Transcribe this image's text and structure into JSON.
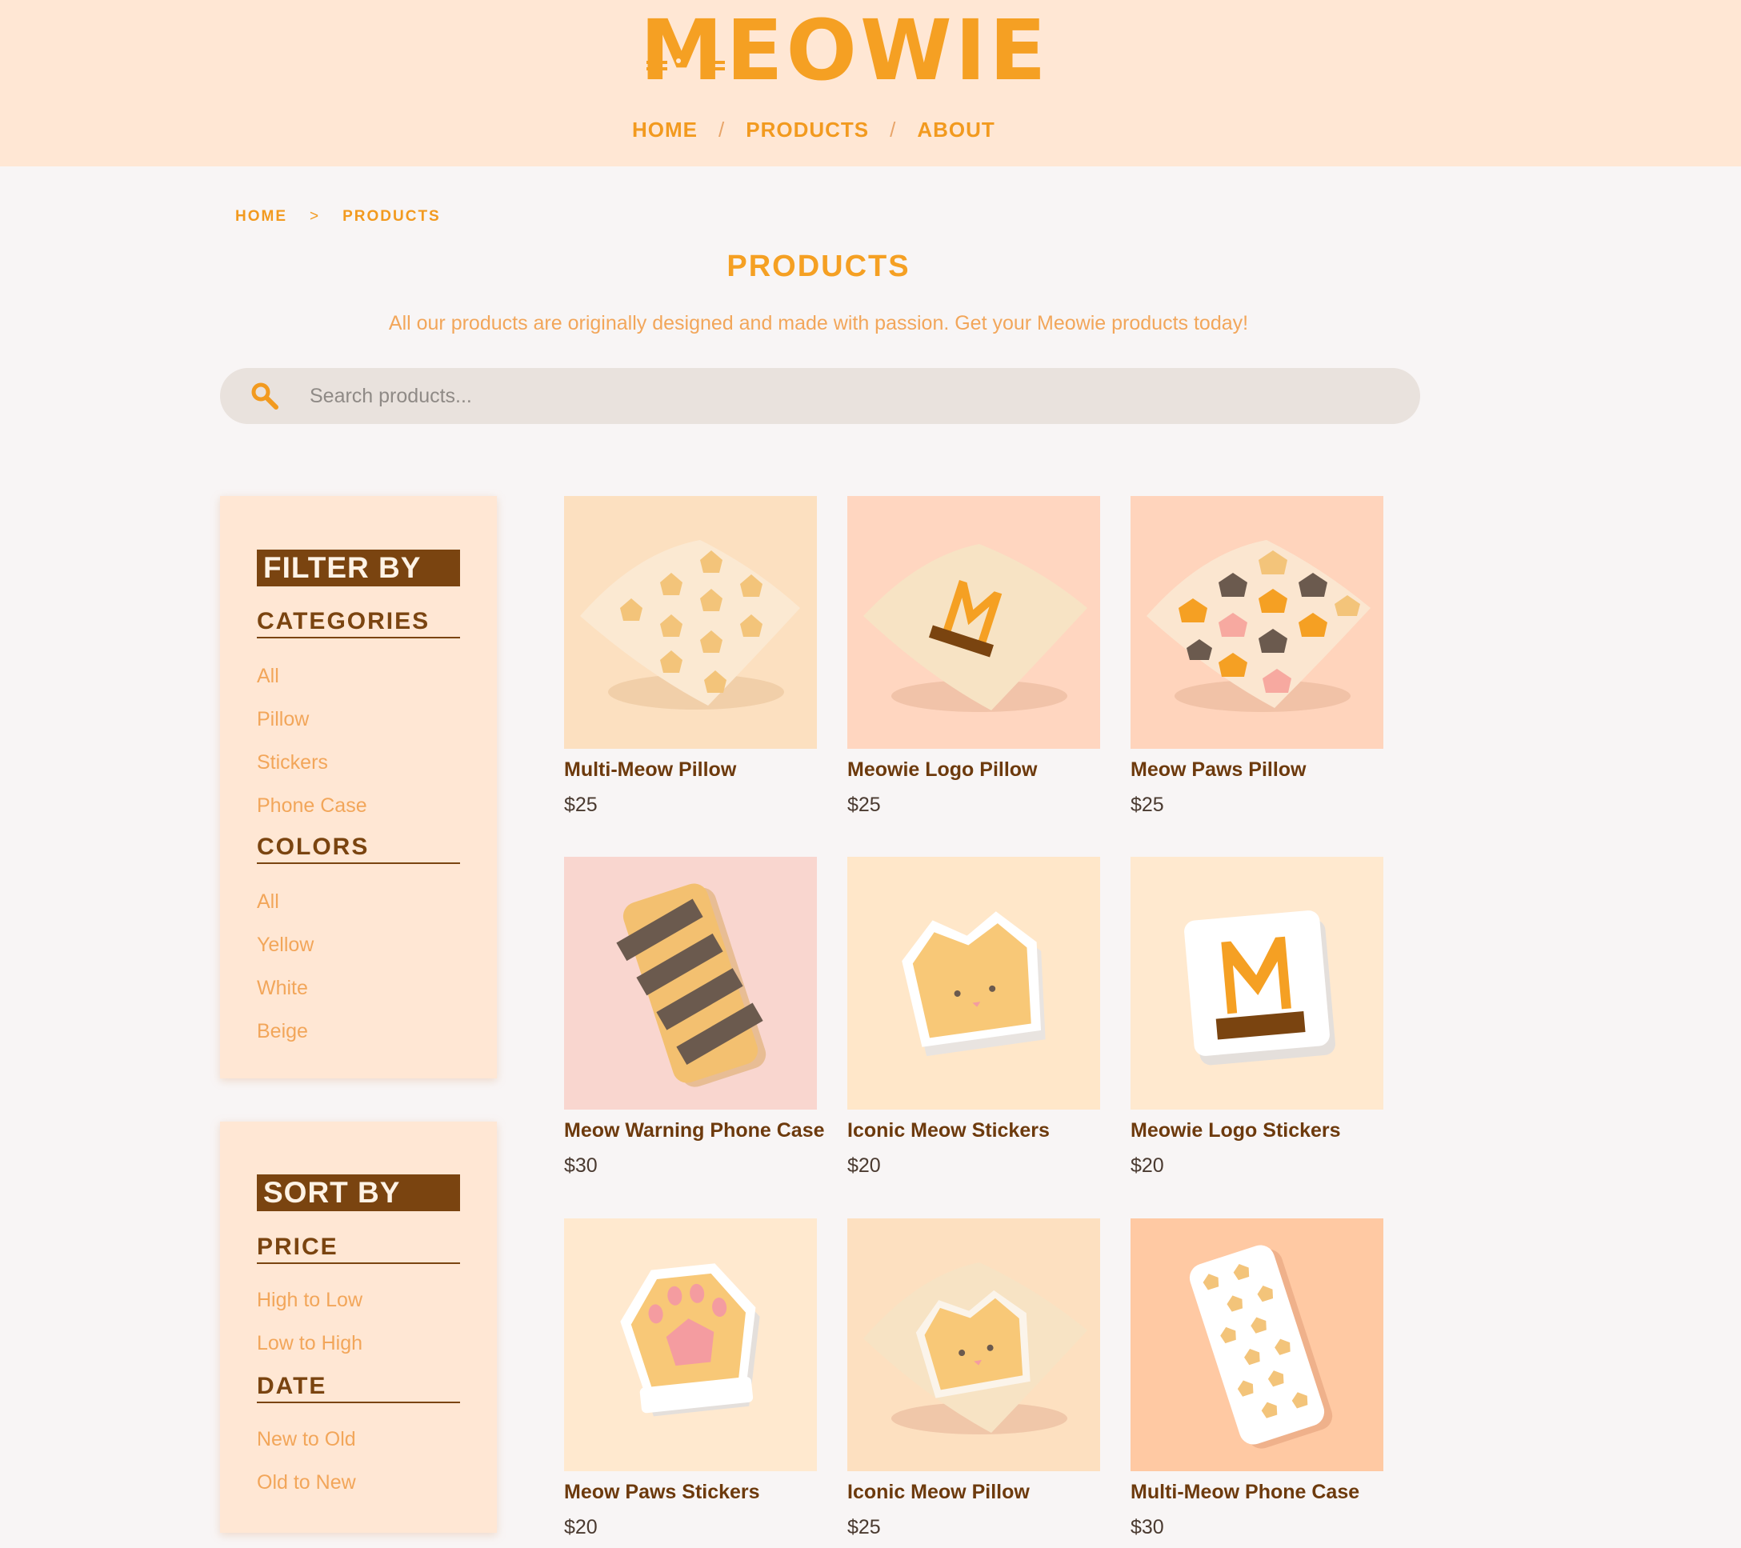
{
  "site": {
    "logo_text": "MEOWIE",
    "nav": {
      "home": "HOME",
      "products": "PRODUCTS",
      "about": "ABOUT",
      "separator": "/"
    }
  },
  "breadcrumb": {
    "home": "HOME",
    "separator": ">",
    "current": "PRODUCTS"
  },
  "page": {
    "title": "PRODUCTS",
    "subtitle": "All our products are originally designed and made with passion. Get your Meowie products today!"
  },
  "search": {
    "placeholder": "Search products..."
  },
  "filter": {
    "heading": "FILTER BY",
    "categories": {
      "title": "CATEGORIES",
      "options": [
        "All",
        "Pillow",
        "Stickers",
        "Phone Case"
      ]
    },
    "colors": {
      "title": "COLORS",
      "options": [
        "All",
        "Yellow",
        "White",
        "Beige"
      ]
    }
  },
  "sort": {
    "heading": "SORT BY",
    "price": {
      "title": "PRICE",
      "options": [
        "High to Low",
        "Low to High"
      ]
    },
    "date": {
      "title": "DATE",
      "options": [
        "New to Old",
        "Old to New"
      ]
    }
  },
  "products": [
    {
      "name": "Multi-Meow Pillow",
      "price": "$25",
      "bg": "#fce0c0"
    },
    {
      "name": "Meowie Logo Pillow",
      "price": "$25",
      "bg": "#ffd6c0"
    },
    {
      "name": "Meow Paws Pillow",
      "price": "$25",
      "bg": "#ffd4bc"
    },
    {
      "name": "Meow Warning Phone Case",
      "price": "$30",
      "bg": "#f9d6cf"
    },
    {
      "name": "Iconic Meow Stickers",
      "price": "$20",
      "bg": "#ffe7c9"
    },
    {
      "name": "Meowie Logo Stickers",
      "price": "$20",
      "bg": "#ffe9cf"
    },
    {
      "name": "Meow Paws Stickers",
      "price": "$20",
      "bg": "#ffe9cf"
    },
    {
      "name": "Iconic Meow Pillow",
      "price": "$25",
      "bg": "#fde0c0"
    },
    {
      "name": "Multi-Meow Phone Case",
      "price": "$30",
      "bg": "#ffc9a3"
    }
  ],
  "colors": {
    "header_bg": "#ffe7d4",
    "accent_orange": "#f5a023",
    "dark_brown": "#7a4410",
    "page_bg": "#f8f5f5"
  },
  "icons": {
    "search": "magnifier-icon"
  }
}
